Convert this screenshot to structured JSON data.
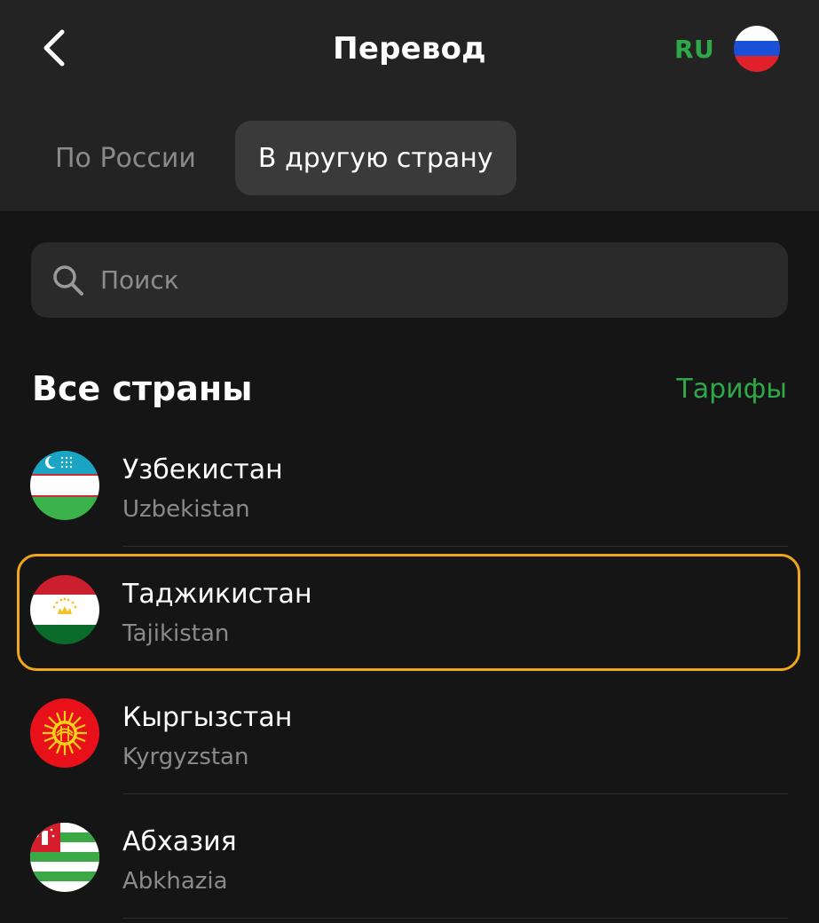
{
  "header": {
    "title": "Перевод",
    "language_code": "RU",
    "language_flag_icon": "russia-flag-icon"
  },
  "tabs": [
    {
      "label": "По России",
      "active": false
    },
    {
      "label": "В другую страну",
      "active": true
    }
  ],
  "search": {
    "placeholder": "Поиск",
    "value": ""
  },
  "section": {
    "title": "Все страны",
    "tariffs_label": "Тарифы"
  },
  "countries": [
    {
      "name": "Узбекистан",
      "name_en": "Uzbekistan",
      "flag_icon": "uzbekistan-flag-icon",
      "highlighted": false
    },
    {
      "name": "Таджикистан",
      "name_en": "Tajikistan",
      "flag_icon": "tajikistan-flag-icon",
      "highlighted": true
    },
    {
      "name": "Кыргызстан",
      "name_en": "Kyrgyzstan",
      "flag_icon": "kyrgyzstan-flag-icon",
      "highlighted": false
    },
    {
      "name": "Абхазия",
      "name_en": "Abkhazia",
      "flag_icon": "abkhazia-flag-icon",
      "highlighted": false
    }
  ],
  "colors": {
    "background": "#151515",
    "header_background": "#232323",
    "accent_green": "#2fa84a",
    "highlight_border": "#f0a51a",
    "secondary_text": "#8a8a8a"
  }
}
